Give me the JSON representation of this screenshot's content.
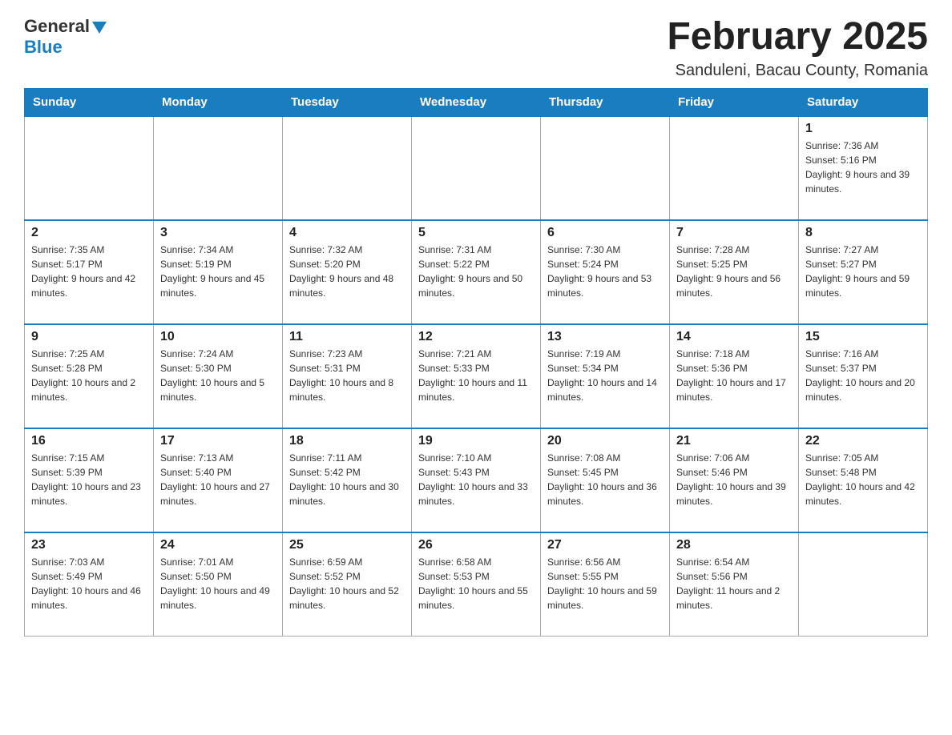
{
  "header": {
    "logo_general": "General",
    "logo_blue": "Blue",
    "month_title": "February 2025",
    "location": "Sanduleni, Bacau County, Romania"
  },
  "days_of_week": [
    "Sunday",
    "Monday",
    "Tuesday",
    "Wednesday",
    "Thursday",
    "Friday",
    "Saturday"
  ],
  "weeks": [
    [
      {
        "day": "",
        "info": ""
      },
      {
        "day": "",
        "info": ""
      },
      {
        "day": "",
        "info": ""
      },
      {
        "day": "",
        "info": ""
      },
      {
        "day": "",
        "info": ""
      },
      {
        "day": "",
        "info": ""
      },
      {
        "day": "1",
        "info": "Sunrise: 7:36 AM\nSunset: 5:16 PM\nDaylight: 9 hours and 39 minutes."
      }
    ],
    [
      {
        "day": "2",
        "info": "Sunrise: 7:35 AM\nSunset: 5:17 PM\nDaylight: 9 hours and 42 minutes."
      },
      {
        "day": "3",
        "info": "Sunrise: 7:34 AM\nSunset: 5:19 PM\nDaylight: 9 hours and 45 minutes."
      },
      {
        "day": "4",
        "info": "Sunrise: 7:32 AM\nSunset: 5:20 PM\nDaylight: 9 hours and 48 minutes."
      },
      {
        "day": "5",
        "info": "Sunrise: 7:31 AM\nSunset: 5:22 PM\nDaylight: 9 hours and 50 minutes."
      },
      {
        "day": "6",
        "info": "Sunrise: 7:30 AM\nSunset: 5:24 PM\nDaylight: 9 hours and 53 minutes."
      },
      {
        "day": "7",
        "info": "Sunrise: 7:28 AM\nSunset: 5:25 PM\nDaylight: 9 hours and 56 minutes."
      },
      {
        "day": "8",
        "info": "Sunrise: 7:27 AM\nSunset: 5:27 PM\nDaylight: 9 hours and 59 minutes."
      }
    ],
    [
      {
        "day": "9",
        "info": "Sunrise: 7:25 AM\nSunset: 5:28 PM\nDaylight: 10 hours and 2 minutes."
      },
      {
        "day": "10",
        "info": "Sunrise: 7:24 AM\nSunset: 5:30 PM\nDaylight: 10 hours and 5 minutes."
      },
      {
        "day": "11",
        "info": "Sunrise: 7:23 AM\nSunset: 5:31 PM\nDaylight: 10 hours and 8 minutes."
      },
      {
        "day": "12",
        "info": "Sunrise: 7:21 AM\nSunset: 5:33 PM\nDaylight: 10 hours and 11 minutes."
      },
      {
        "day": "13",
        "info": "Sunrise: 7:19 AM\nSunset: 5:34 PM\nDaylight: 10 hours and 14 minutes."
      },
      {
        "day": "14",
        "info": "Sunrise: 7:18 AM\nSunset: 5:36 PM\nDaylight: 10 hours and 17 minutes."
      },
      {
        "day": "15",
        "info": "Sunrise: 7:16 AM\nSunset: 5:37 PM\nDaylight: 10 hours and 20 minutes."
      }
    ],
    [
      {
        "day": "16",
        "info": "Sunrise: 7:15 AM\nSunset: 5:39 PM\nDaylight: 10 hours and 23 minutes."
      },
      {
        "day": "17",
        "info": "Sunrise: 7:13 AM\nSunset: 5:40 PM\nDaylight: 10 hours and 27 minutes."
      },
      {
        "day": "18",
        "info": "Sunrise: 7:11 AM\nSunset: 5:42 PM\nDaylight: 10 hours and 30 minutes."
      },
      {
        "day": "19",
        "info": "Sunrise: 7:10 AM\nSunset: 5:43 PM\nDaylight: 10 hours and 33 minutes."
      },
      {
        "day": "20",
        "info": "Sunrise: 7:08 AM\nSunset: 5:45 PM\nDaylight: 10 hours and 36 minutes."
      },
      {
        "day": "21",
        "info": "Sunrise: 7:06 AM\nSunset: 5:46 PM\nDaylight: 10 hours and 39 minutes."
      },
      {
        "day": "22",
        "info": "Sunrise: 7:05 AM\nSunset: 5:48 PM\nDaylight: 10 hours and 42 minutes."
      }
    ],
    [
      {
        "day": "23",
        "info": "Sunrise: 7:03 AM\nSunset: 5:49 PM\nDaylight: 10 hours and 46 minutes."
      },
      {
        "day": "24",
        "info": "Sunrise: 7:01 AM\nSunset: 5:50 PM\nDaylight: 10 hours and 49 minutes."
      },
      {
        "day": "25",
        "info": "Sunrise: 6:59 AM\nSunset: 5:52 PM\nDaylight: 10 hours and 52 minutes."
      },
      {
        "day": "26",
        "info": "Sunrise: 6:58 AM\nSunset: 5:53 PM\nDaylight: 10 hours and 55 minutes."
      },
      {
        "day": "27",
        "info": "Sunrise: 6:56 AM\nSunset: 5:55 PM\nDaylight: 10 hours and 59 minutes."
      },
      {
        "day": "28",
        "info": "Sunrise: 6:54 AM\nSunset: 5:56 PM\nDaylight: 11 hours and 2 minutes."
      },
      {
        "day": "",
        "info": ""
      }
    ]
  ]
}
